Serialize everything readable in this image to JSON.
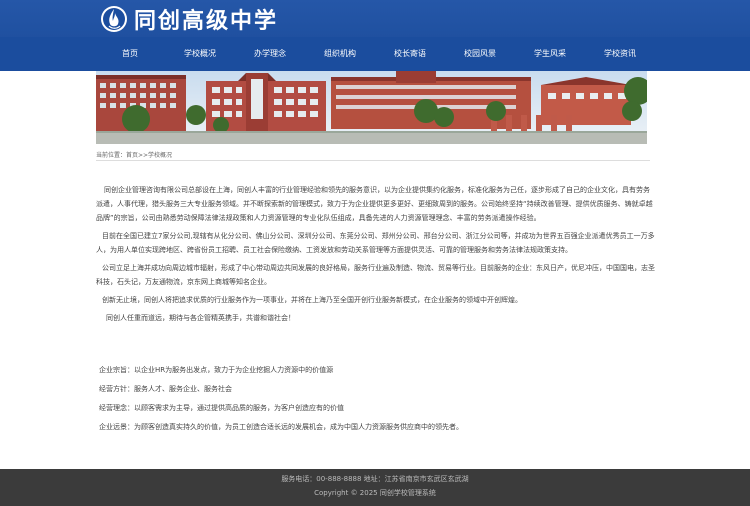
{
  "header": {
    "school_name": "同创高级中学",
    "logo_icon": "flame-emblem-icon"
  },
  "nav": {
    "items": [
      "首页",
      "学校概况",
      "办学理念",
      "组织机构",
      "校长寄语",
      "校园风景",
      "学生风采",
      "学校资讯"
    ]
  },
  "breadcrumb": "当前位置：首页>>学校概况",
  "content": {
    "paragraphs": [
      "同创企业管理咨询有限公司总部设在上海，同创人丰富的行业管理经验和领先的服务意识，以为企业提供集约化服务，标准化服务为己任，逐步形成了自己的企业文化，具有劳务派遣，人事代理，猎头服务三大专业服务领域。并不断探索新的管理模式，致力于为企业提供更多更好、更细致周到的服务。公司始终坚持“持续改善管理、提供优质服务、铸就卓越品牌”的宗旨，公司由熟悉劳动保障法律法规政策和人力资源管理的专业化队伍组成，具备先进的人力资源管理理念、丰富的劳务派遣操作经验。",
      "目前在全国已建立7家分公司,现辖有从化分公司、佛山分公司、深圳分公司、东莞分公司、郑州分公司、邢台分公司、浙江分公司等，并成功为世界五百强企业派遣优秀员工一万多人，为用人单位实现跨地区、跨省份员工招聘、员工社会保险缴纳、工资发放和劳动关系管理等方面提供灵活、可靠的管理服务和劳务法律法规政策支持。",
      "公司立足上海并成功向周边城市辐射，形成了中心带动周边共同发展的良好格局，服务行业遍及制造、物流、贸易等行业。目前服务的企业：东风日产，优尼冲压，中国国电，志圣科技，石头记，万友通物流，京东网上商城等知名企业。",
      "创新无止境，同创人将把追求优质的行业服务作为一项事业，并将在上海乃至全国开创行业服务新模式，在企业服务的领域中开创辉煌。",
      "同创人任重而道远，期待与各企管精英携手，共谱和谐社会！"
    ],
    "culture": [
      "企业宗旨：以企业HR为服务出发点，致力于为企业挖掘人力资源中的价值源",
      "经营方针：服务人才、服务企业、服务社会",
      "经营理念：以顾客需求为主导，通过提供高品质的服务，为客户创造应有的价值",
      "企业远景：为顾客创造真实持久的价值，为员工创造合适长远的发展机会，成为中国人力资源服务供应商中的领先者。"
    ]
  },
  "footer": {
    "line1": "服务电话：00-888-8888 地址：江苏省南京市玄武区玄武湖",
    "line2": "Copyright © 2025 同创学校管理系统"
  },
  "colors": {
    "header_blue": "#1b4d9e",
    "footer_gray": "#3b3b3b"
  }
}
